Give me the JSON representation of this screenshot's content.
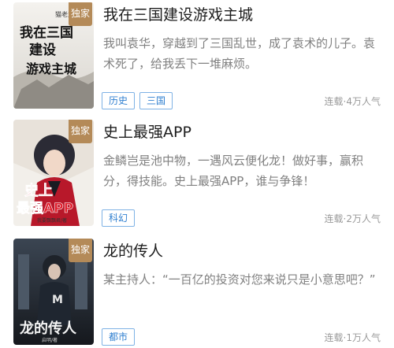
{
  "books": [
    {
      "badge": "独家",
      "title": "我在三国建设游戏主城",
      "description": "我叫袁华，穿越到了三国乱世，成了袁术的儿子。袁术死了，给我丢下一堆麻烦。",
      "tags": [
        "历史",
        "三国"
      ],
      "meta": "连载·4万人气",
      "cover_text": {
        "author": "猫老九",
        "title_lines": [
          "我在三国",
          "建设",
          "游戏主城"
        ]
      }
    },
    {
      "badge": "独家",
      "title": "史上最强APP",
      "description": "金鳞岂是池中物，一遇风云便化龙！做好事，赢积分，得技能。史上最强APP，谁与争锋！",
      "tags": [
        "科幻"
      ],
      "meta": "连载·2万人气",
      "cover_text": {
        "title_lines": [
          "史上",
          "最强APP"
        ],
        "author": "我要飘飘君/著"
      }
    },
    {
      "badge": "独家",
      "title": "龙的传人",
      "description": "某主持人：“一百亿的投资对您来说只是小意思吧？”",
      "tags": [
        "都市"
      ],
      "meta": "连载·1万人气",
      "cover_text": {
        "title_lines": [
          "龙的传人"
        ],
        "author": "启明/著"
      }
    }
  ]
}
